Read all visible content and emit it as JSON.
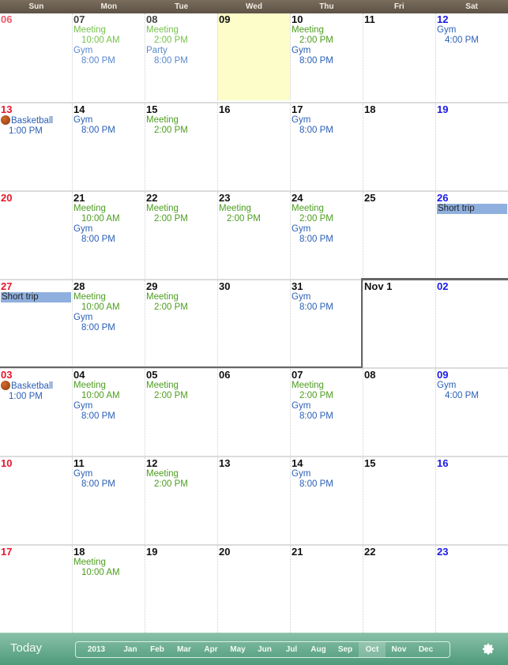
{
  "header": {
    "days": [
      "Sun",
      "Mon",
      "Tue",
      "Wed",
      "Thu",
      "Fri",
      "Sat"
    ]
  },
  "weeks": [
    [
      {
        "label": "06",
        "past": true,
        "events": []
      },
      {
        "label": "07",
        "past": true,
        "events": [
          {
            "type": "meeting",
            "title": "Meeting",
            "time": "10:00 AM"
          },
          {
            "type": "gym",
            "title": "Gym",
            "time": "8:00 PM"
          }
        ]
      },
      {
        "label": "08",
        "past": true,
        "events": [
          {
            "type": "meeting",
            "title": "Meeting",
            "time": "2:00 PM"
          },
          {
            "type": "gym",
            "title": "Party",
            "time": "8:00 PM"
          }
        ]
      },
      {
        "label": "09",
        "today": true,
        "events": []
      },
      {
        "label": "10",
        "events": [
          {
            "type": "meeting",
            "title": "Meeting",
            "time": "2:00 PM"
          },
          {
            "type": "gym",
            "title": "Gym",
            "time": "8:00 PM"
          }
        ]
      },
      {
        "label": "11",
        "events": []
      },
      {
        "label": "12",
        "events": [
          {
            "type": "gym",
            "title": "Gym",
            "time": "4:00 PM"
          }
        ]
      }
    ],
    [
      {
        "label": "13",
        "events": [
          {
            "type": "basket",
            "title": "Basketball",
            "time": "1:00 PM",
            "icon": "basketball-icon"
          }
        ]
      },
      {
        "label": "14",
        "events": [
          {
            "type": "gym",
            "title": "Gym",
            "time": "8:00 PM"
          }
        ]
      },
      {
        "label": "15",
        "events": [
          {
            "type": "meeting",
            "title": "Meeting",
            "time": "2:00 PM"
          }
        ]
      },
      {
        "label": "16",
        "events": []
      },
      {
        "label": "17",
        "events": [
          {
            "type": "gym",
            "title": "Gym",
            "time": "8:00 PM"
          }
        ]
      },
      {
        "label": "18",
        "events": []
      },
      {
        "label": "19",
        "events": []
      }
    ],
    [
      {
        "label": "20",
        "events": []
      },
      {
        "label": "21",
        "events": [
          {
            "type": "meeting",
            "title": "Meeting",
            "time": "10:00 AM"
          },
          {
            "type": "gym",
            "title": "Gym",
            "time": "8:00 PM"
          }
        ]
      },
      {
        "label": "22",
        "events": [
          {
            "type": "meeting",
            "title": "Meeting",
            "time": "2:00 PM"
          }
        ]
      },
      {
        "label": "23",
        "events": [
          {
            "type": "meeting",
            "title": "Meeting",
            "time": "2:00 PM"
          }
        ]
      },
      {
        "label": "24",
        "events": [
          {
            "type": "meeting",
            "title": "Meeting",
            "time": "2:00 PM"
          },
          {
            "type": "gym",
            "title": "Gym",
            "time": "8:00 PM"
          }
        ]
      },
      {
        "label": "25",
        "events": []
      },
      {
        "label": "26",
        "events": [
          {
            "type": "trip",
            "title": "Short trip"
          }
        ]
      }
    ],
    [
      {
        "label": "27",
        "events": [
          {
            "type": "trip",
            "title": "Short trip"
          }
        ]
      },
      {
        "label": "28",
        "events": [
          {
            "type": "meeting",
            "title": "Meeting",
            "time": "10:00 AM"
          },
          {
            "type": "gym",
            "title": "Gym",
            "time": "8:00 PM"
          }
        ]
      },
      {
        "label": "29",
        "events": [
          {
            "type": "meeting",
            "title": "Meeting",
            "time": "2:00 PM"
          }
        ]
      },
      {
        "label": "30",
        "events": []
      },
      {
        "label": "31",
        "events": [
          {
            "type": "gym",
            "title": "Gym",
            "time": "8:00 PM"
          }
        ]
      },
      {
        "label": "Nov 1",
        "events": []
      },
      {
        "label": "02",
        "events": []
      }
    ],
    [
      {
        "label": "03",
        "events": [
          {
            "type": "basket",
            "title": "Basketball",
            "time": "1:00 PM",
            "icon": "basketball-icon"
          }
        ]
      },
      {
        "label": "04",
        "events": [
          {
            "type": "meeting",
            "title": "Meeting",
            "time": "10:00 AM"
          },
          {
            "type": "gym",
            "title": "Gym",
            "time": "8:00 PM"
          }
        ]
      },
      {
        "label": "05",
        "events": [
          {
            "type": "meeting",
            "title": "Meeting",
            "time": "2:00 PM"
          }
        ]
      },
      {
        "label": "06",
        "events": []
      },
      {
        "label": "07",
        "events": [
          {
            "type": "meeting",
            "title": "Meeting",
            "time": "2:00 PM"
          },
          {
            "type": "gym",
            "title": "Gym",
            "time": "8:00 PM"
          }
        ]
      },
      {
        "label": "08",
        "events": []
      },
      {
        "label": "09",
        "events": [
          {
            "type": "gym",
            "title": "Gym",
            "time": "4:00 PM"
          }
        ]
      }
    ],
    [
      {
        "label": "10",
        "events": []
      },
      {
        "label": "11",
        "events": [
          {
            "type": "gym",
            "title": "Gym",
            "time": "8:00 PM"
          }
        ]
      },
      {
        "label": "12",
        "events": [
          {
            "type": "meeting",
            "title": "Meeting",
            "time": "2:00 PM"
          }
        ]
      },
      {
        "label": "13",
        "events": []
      },
      {
        "label": "14",
        "events": [
          {
            "type": "gym",
            "title": "Gym",
            "time": "8:00 PM"
          }
        ]
      },
      {
        "label": "15",
        "events": []
      },
      {
        "label": "16",
        "events": []
      }
    ],
    [
      {
        "label": "17",
        "events": []
      },
      {
        "label": "18",
        "events": [
          {
            "type": "meeting",
            "title": "Meeting",
            "time": "10:00 AM"
          }
        ]
      },
      {
        "label": "19",
        "events": []
      },
      {
        "label": "20",
        "events": []
      },
      {
        "label": "21",
        "events": []
      },
      {
        "label": "22",
        "events": []
      },
      {
        "label": "23",
        "events": []
      }
    ]
  ],
  "toolbar": {
    "today_label": "Today",
    "year": "2013",
    "months": [
      "Jan",
      "Feb",
      "Mar",
      "Apr",
      "May",
      "Jun",
      "Jul",
      "Aug",
      "Sep",
      "Oct",
      "Nov",
      "Dec"
    ],
    "selected_month": "Oct",
    "settings_icon": "gear-icon"
  },
  "colors": {
    "header_bg": "#6b5f52",
    "today_bg": "#fdfdc9",
    "meeting": "#4c9d1e",
    "gym": "#2a5fb5",
    "sunday": "#e8162b",
    "saturday": "#1a1ae6",
    "trip_bg": "#8fb0de",
    "toolbar_bg": "#6aab8f"
  }
}
